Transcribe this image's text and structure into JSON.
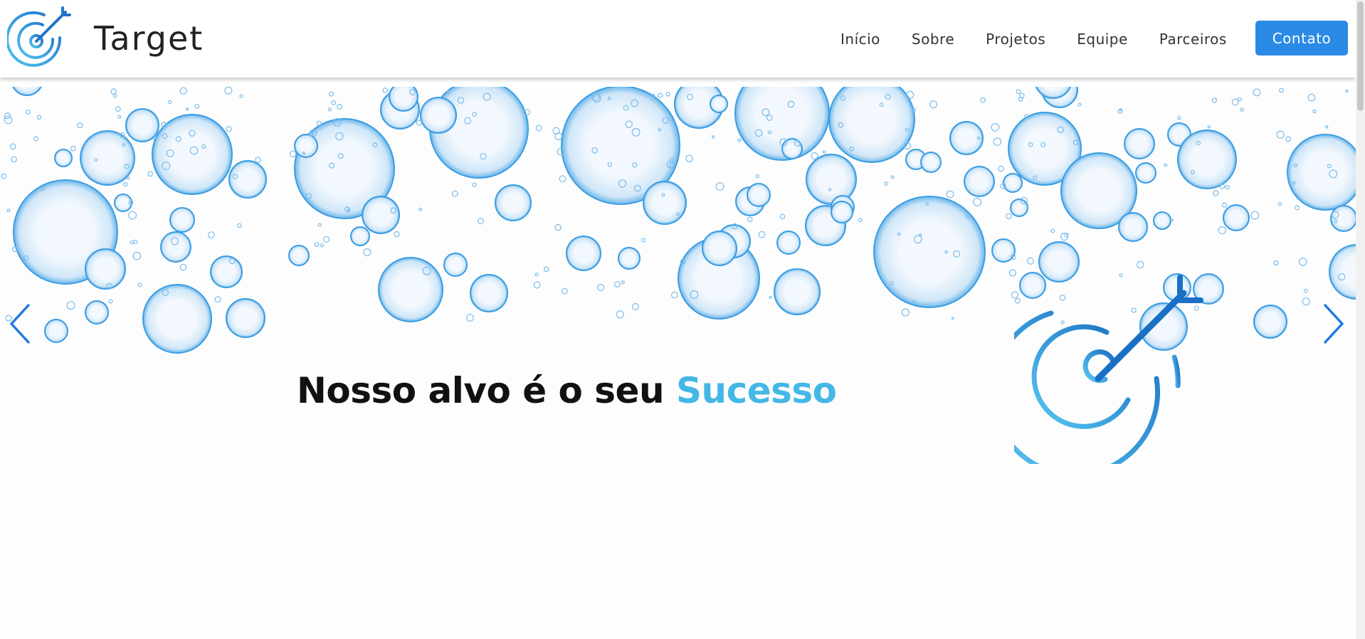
{
  "header": {
    "brand_name": "Target",
    "logo_icon": "target-arrow-icon",
    "nav": [
      {
        "label": "Início"
      },
      {
        "label": "Sobre"
      },
      {
        "label": "Projetos"
      },
      {
        "label": "Equipe"
      },
      {
        "label": "Parceiros"
      }
    ],
    "contact_label": "Contato"
  },
  "hero": {
    "headline_main": "Nosso alvo é o seu ",
    "headline_accent": "Sucesso",
    "prev_icon": "chevron-left-icon",
    "next_icon": "chevron-right-icon",
    "illustration_icon": "target-arrow-icon"
  },
  "colors": {
    "accent_blue": "#2a8ae6",
    "light_blue": "#45b7e6",
    "bubble_stroke": "#3b9de3",
    "bubble_fill": "#e3f1fb"
  }
}
